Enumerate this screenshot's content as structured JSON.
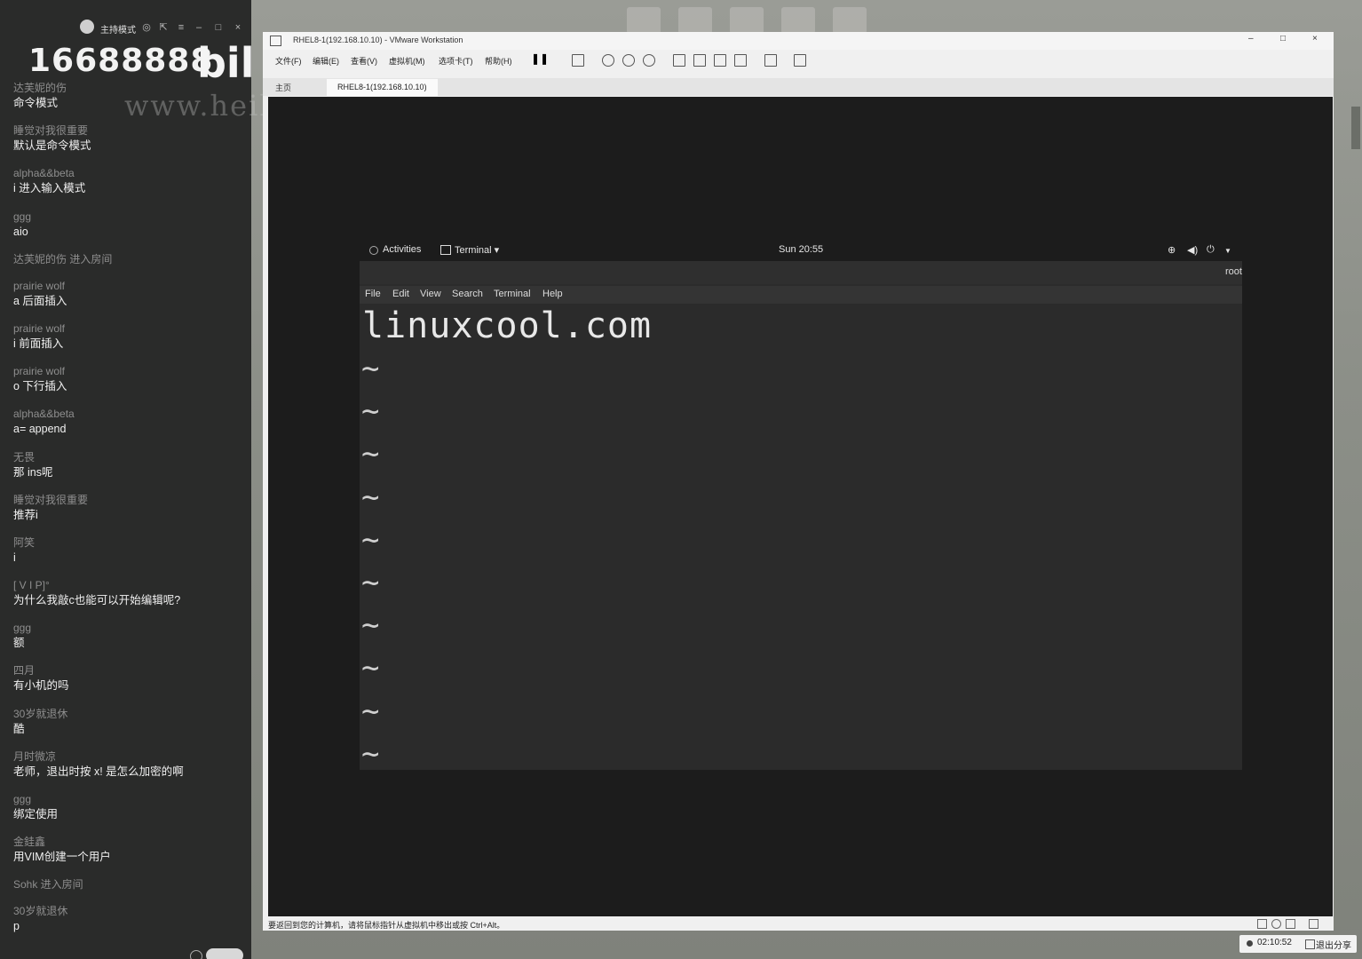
{
  "chat": {
    "host_mode": "主持模式",
    "big_number": "16688888",
    "logo": "bili",
    "watermark": "www.heike123.com",
    "messages": [
      {
        "user": "达芙妮的伤",
        "text": "命令模式"
      },
      {
        "user": "睡觉对我很重要",
        "text": "默认是命令模式"
      },
      {
        "user": "alpha&&beta",
        "text": "i 进入输入模式"
      },
      {
        "user": "ggg",
        "text": "aio"
      },
      {
        "user": "达芙妮的伤 进入房间",
        "text": "",
        "system": true
      },
      {
        "user": "prairie wolf",
        "text": "a  后面插入"
      },
      {
        "user": "prairie wolf",
        "text": "i  前面插入"
      },
      {
        "user": "prairie wolf",
        "text": "o 下行插入"
      },
      {
        "user": "alpha&&beta",
        "text": "a= append"
      },
      {
        "user": "无畏",
        "text": "那 ins呢"
      },
      {
        "user": "睡觉对我很重要",
        "text": "推荐i"
      },
      {
        "user": "阿笑",
        "text": "i"
      },
      {
        "user": "[    V    I    P]°",
        "text": "为什么我敲c也能可以开始编辑呢?"
      },
      {
        "user": "ggg",
        "text": "额"
      },
      {
        "user": "四月",
        "text": "有小机的吗"
      },
      {
        "user": "30岁就退休",
        "text": "酷"
      },
      {
        "user": "月时微凉",
        "text": "老师，退出时按 x! 是怎么加密的啊"
      },
      {
        "user": "ggg",
        "text": "绑定使用"
      },
      {
        "user": "金銈鑫",
        "text": "用VIM创建一个用户"
      },
      {
        "user": "Sohk 进入房间",
        "text": "",
        "system": true
      },
      {
        "user": "30岁就退休",
        "text": "p"
      }
    ]
  },
  "vmware": {
    "title": "RHEL8-1(192.168.10.10) - VMware Workstation",
    "menus": [
      "文件(F)",
      "编辑(E)",
      "查看(V)",
      "虚拟机(M)",
      "选项卡(T)",
      "帮助(H)"
    ],
    "tab_home": "主页",
    "tab_vm": "RHEL8-1(192.168.10.10)",
    "status_text": "要返回到您的计算机，请将鼠标指针从虚拟机中移出或按 Ctrl+Alt。"
  },
  "guest": {
    "activities": "Activities",
    "app_name": "Terminal ▾",
    "clock": "Sun 20:55",
    "term_title": "root",
    "term_menus": [
      "File",
      "Edit",
      "View",
      "Search",
      "Terminal",
      "Help"
    ],
    "file_line": "linuxcool.com",
    "tilde": "~",
    "tilde_count": 10
  },
  "taskbar": {
    "rec_time": "02:10:52",
    "exit_share": "退出分享"
  }
}
